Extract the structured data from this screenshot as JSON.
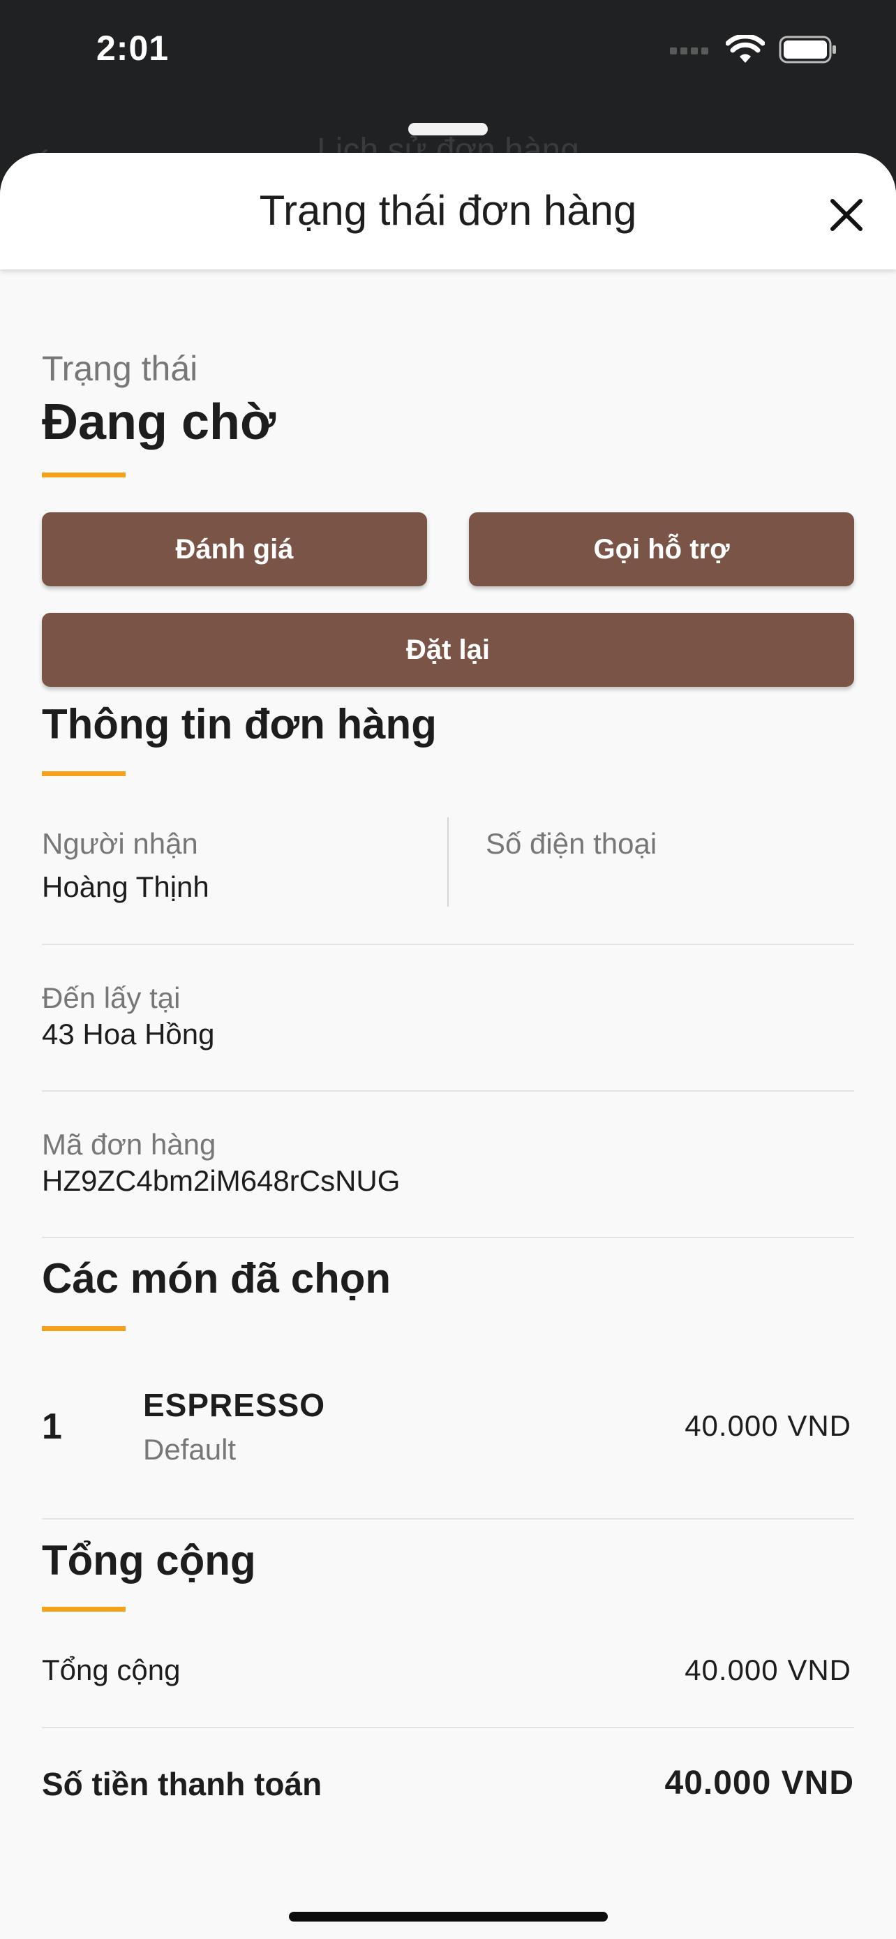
{
  "status_bar": {
    "time": "2:01"
  },
  "background_screen": {
    "title": "Lịch sử đơn hàng"
  },
  "sheet": {
    "title": "Trạng thái đơn hàng",
    "status_label": "Trạng thái",
    "status_value": "Đang chờ",
    "buttons": {
      "rate": "Đánh giá",
      "support": "Gọi hỗ trợ",
      "reorder": "Đặt lại"
    },
    "order_info": {
      "heading": "Thông tin đơn hàng",
      "recipient_label": "Người nhận",
      "recipient_value": "Hoàng Thịnh",
      "phone_label": "Số điện thoại",
      "pickup_label": "Đến lấy tại",
      "pickup_value": "43 Hoa Hồng",
      "order_id_label": "Mã đơn hàng",
      "order_id_value": "HZ9ZC4bm2iM648rCsNUG"
    },
    "items": {
      "heading": "Các món đã chọn",
      "list": [
        {
          "qty": "1",
          "name": "ESPRESSO",
          "variant": "Default",
          "price": "40.000 VND"
        }
      ]
    },
    "totals": {
      "heading": "Tổng cộng",
      "subtotal_label": "Tổng cộng",
      "subtotal_value": "40.000 VND",
      "payment_label": "Số tiền thanh toán",
      "payment_value": "40.000 VND"
    }
  },
  "colors": {
    "accent": "#f4a21b",
    "button": "#7a5547",
    "status_bar": "#202122",
    "sheet_bg": "#f9f9f9"
  }
}
